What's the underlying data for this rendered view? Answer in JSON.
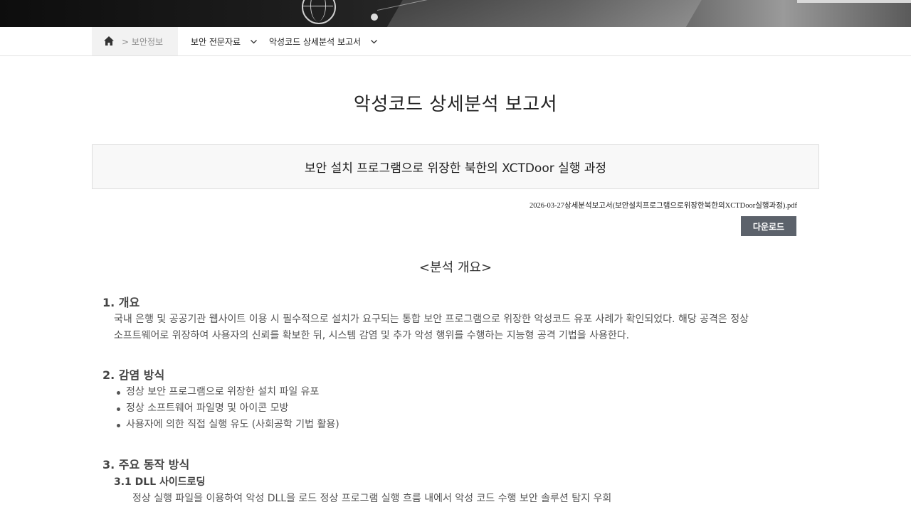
{
  "nav": {
    "crumb": "> 보안정보",
    "dropdown1": "보안 전문자료",
    "dropdown2": "악성코드 상세분석 보고서"
  },
  "title": "악성코드 상세분석 보고서",
  "subtitle": "보안 설치 프로그램으로 위장한 북한의 XCTDoor 실행 과정",
  "file": {
    "name": "2026-03-27상세분석보고서(보안설치프로그램으로위장한북한의XCTDoor실행과정).pdf",
    "download_label": "다운로드"
  },
  "content": {
    "heading": "<분석 개요>",
    "s1": {
      "title": "1. 개요",
      "line1": "국내 은행 및 공공기관 웹사이트 이용 시 필수적으로 설치가 요구되는 통합 보안 프로그램으로 위장한 악성코드 유포 사례가 확인되었다. 해당 공격은 정상",
      "line2": "소프트웨어로 위장하여 사용자의 신뢰를 확보한 뒤, 시스템 감염 및 추가 악성 행위를 수행하는 지능형 공격 기법을 사용한다."
    },
    "s2": {
      "title": "2. 감염 방식",
      "items": [
        "정상 보안 프로그램으로 위장한 설치 파일 유포",
        "정상 소프트웨어 파일명 및 아이콘 모방",
        "사용자에 의한 직접 실행 유도 (사회공학 기법 활용)"
      ]
    },
    "s3": {
      "title": "3. 주요 동작 방식",
      "sub_title": "3.1 DLL 사이드로딩",
      "sub_text": "정상 실행 파일을 이용하여 악성 DLL을 로드 정상 프로그램 실행 흐름 내에서 악성 코드 수행 보안 솔루션 탐지 우회"
    }
  }
}
